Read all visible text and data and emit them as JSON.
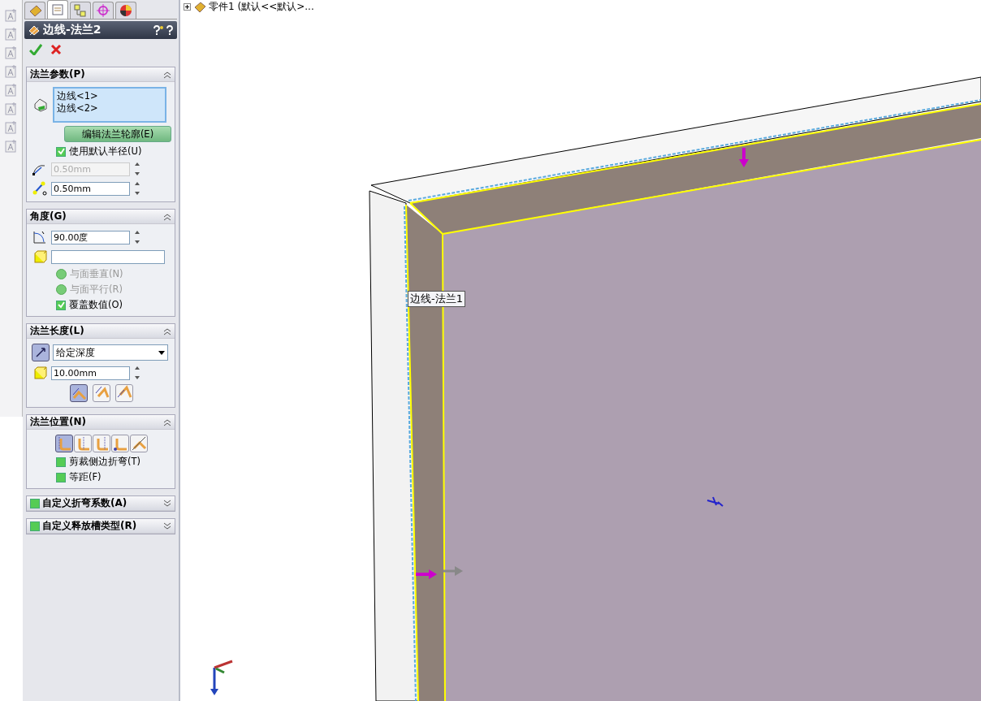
{
  "tree": {
    "expanded": false,
    "label": "零件1 (默认<<默认>..."
  },
  "panel_tabs": [
    {
      "selected": false
    },
    {
      "selected": true
    },
    {
      "selected": false
    },
    {
      "selected": false
    },
    {
      "selected": false
    }
  ],
  "feature": {
    "title": "边线-法兰2"
  },
  "sections": [
    {
      "title": "法兰参数(P)",
      "expanded": true,
      "items": [
        {
          "kind": "selection-list",
          "entries": [
            "边线<1>",
            "边线<2>"
          ]
        },
        {
          "kind": "button",
          "label": "编辑法兰轮廓(E)"
        },
        {
          "kind": "checkbox",
          "label": "使用默认半径(U)",
          "checked": true
        },
        {
          "kind": "spin-field",
          "value": "0.50mm",
          "disabled": true
        },
        {
          "kind": "spin-field",
          "value": "0.50mm",
          "disabled": false
        }
      ]
    },
    {
      "title": "角度(G)",
      "expanded": true,
      "items": [
        {
          "kind": "spin-field",
          "value": "90.00度",
          "disabled": false
        },
        {
          "kind": "selection-field"
        },
        {
          "kind": "radio",
          "label": "与面垂直(N)",
          "selected": false,
          "disabled": true
        },
        {
          "kind": "radio",
          "label": "与面平行(R)",
          "selected": false,
          "disabled": true
        },
        {
          "kind": "checkbox",
          "label": "覆盖数值(O)",
          "checked": true
        }
      ]
    },
    {
      "title": "法兰长度(L)",
      "expanded": true,
      "items": [
        {
          "kind": "dropdown",
          "value": "给定深度",
          "pressed": true
        },
        {
          "kind": "spin-field",
          "value": "10.00mm",
          "disabled": false
        },
        {
          "kind": "icon-buttons",
          "buttons": [
            {
              "selected": true
            },
            {
              "selected": false
            },
            {
              "selected": false
            }
          ]
        }
      ]
    },
    {
      "title": "法兰位置(N)",
      "expanded": true,
      "items": [
        {
          "kind": "icon-buttons",
          "buttons": [
            {
              "selected": true
            },
            {
              "selected": false
            },
            {
              "selected": false
            },
            {
              "selected": false
            },
            {
              "selected": false
            }
          ]
        },
        {
          "kind": "checkbox",
          "label": "剪裁侧边折弯(T)",
          "checked": false
        },
        {
          "kind": "checkbox",
          "label": "等距(F)",
          "checked": false
        }
      ]
    },
    {
      "title": "自定义折弯系数(A)",
      "expanded": false,
      "checked": false
    },
    {
      "title": "自定义释放槽类型(R)",
      "expanded": false,
      "checked": false
    }
  ],
  "viewport": {
    "tooltip": "边线-法兰1"
  }
}
